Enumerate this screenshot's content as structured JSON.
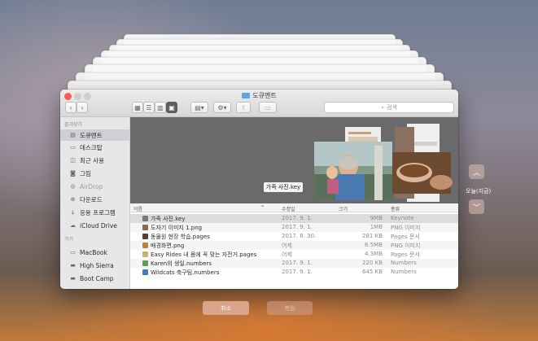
{
  "window": {
    "title": "도큐멘트"
  },
  "toolbar": {
    "back": "‹",
    "forward": "›",
    "search_placeholder": "검색",
    "view_icons": [
      "icon-view-icon",
      "list-view-icon",
      "column-view-icon",
      "gallery-view-icon"
    ],
    "group_icon": "group-icon",
    "action_icon": "gear-icon",
    "share_icon": "share-icon",
    "tag_icon": "tag-icon"
  },
  "sidebar": {
    "favorites_header": "즐겨찾기",
    "favorites": [
      {
        "label": "도큐멘트",
        "icon": "document-icon",
        "selected": true
      },
      {
        "label": "데스크탑",
        "icon": "desktop-icon"
      },
      {
        "label": "최근 사용",
        "icon": "clock-icon"
      },
      {
        "label": "그림",
        "icon": "camera-icon"
      },
      {
        "label": "AirDrop",
        "icon": "airdrop-icon",
        "dim": true
      },
      {
        "label": "다운로드",
        "icon": "download-icon"
      },
      {
        "label": "응용 프로그램",
        "icon": "apps-icon"
      },
      {
        "label": "iCloud Drive",
        "icon": "cloud-icon"
      }
    ],
    "devices_header": "기기",
    "devices": [
      {
        "label": "MacBook",
        "icon": "laptop-icon"
      },
      {
        "label": "High Sierra",
        "icon": "disk-icon"
      },
      {
        "label": "Boot Camp",
        "icon": "disk-icon"
      }
    ]
  },
  "gallery": {
    "caption": "가족 사진.key"
  },
  "columns": {
    "name": "이름",
    "modified": "수정일",
    "size": "크기",
    "kind": "종류"
  },
  "files": [
    {
      "name": "가족 사진.key",
      "date": "2017. 9. 1.",
      "size": "9MB",
      "kind": "Keynote",
      "color": "#7a7a7a",
      "selected": true
    },
    {
      "name": "도자기 이미지 1.png",
      "date": "2017. 9. 1.",
      "size": "1MB",
      "kind": "PNG 이미지",
      "color": "#8a6a4a"
    },
    {
      "name": "동물원 현장 학습.pages",
      "date": "2017. 8. 30.",
      "size": "281 KB",
      "kind": "Pages 문서",
      "color": "#5b4030"
    },
    {
      "name": "배경화면.png",
      "date": "어제",
      "size": "6.5MB",
      "kind": "PNG 이미지",
      "color": "#c08040"
    },
    {
      "name": "Easy Rides 내 몸에 꼭 맞는 자전거.pages",
      "date": "어제",
      "size": "4.3MB",
      "kind": "Pages 문서",
      "color": "#d0b070"
    },
    {
      "name": "Karen의 생일.numbers",
      "date": "2017. 9. 1.",
      "size": "220 KB",
      "kind": "Numbers",
      "color": "#5aa05a"
    },
    {
      "name": "Wildcats 축구팀.numbers",
      "date": "2017. 9. 1.",
      "size": "645 KB",
      "kind": "Numbers",
      "color": "#4a7ab0"
    }
  ],
  "buttons": {
    "cancel": "취소",
    "restore": "복원"
  },
  "timeline": {
    "label": "오늘(지금)",
    "up": "︿",
    "down": "﹀"
  }
}
